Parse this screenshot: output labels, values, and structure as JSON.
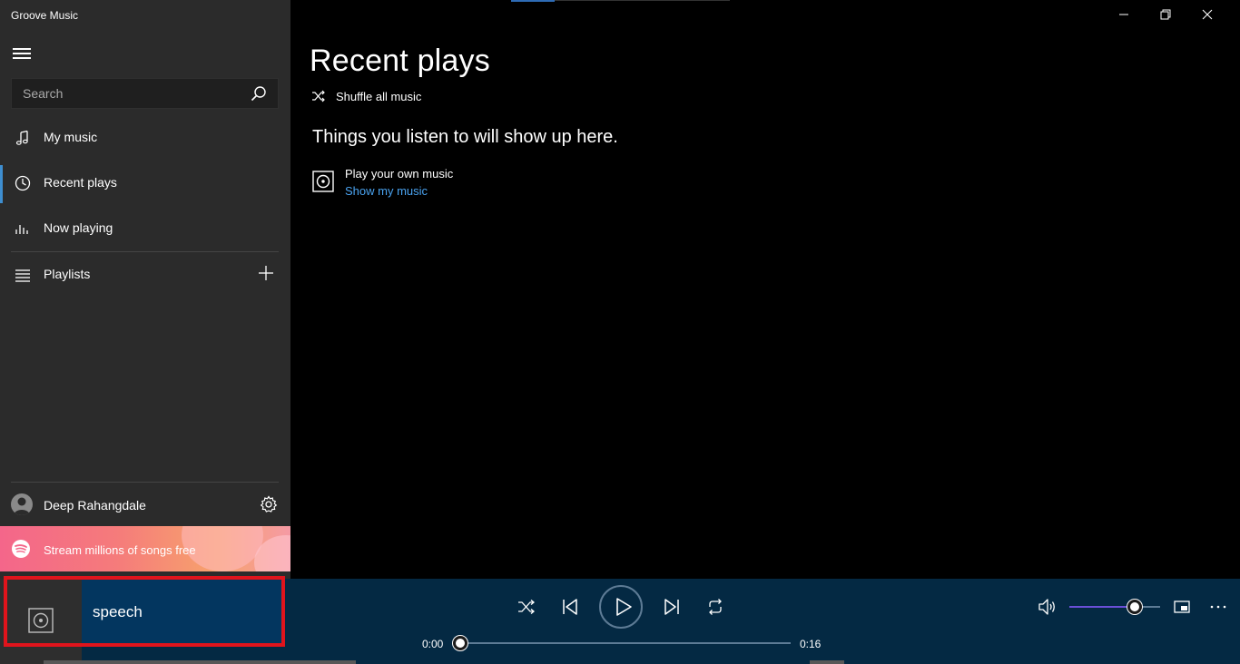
{
  "window": {
    "title": "Groove Music",
    "controls": [
      "minimize-icon",
      "restore-icon",
      "close-icon"
    ]
  },
  "sidebar": {
    "search": {
      "placeholder": "Search",
      "value": ""
    },
    "nav": [
      {
        "label": "My music",
        "icon": "music-note-icon"
      },
      {
        "label": "Recent plays",
        "icon": "clock-icon",
        "active": true
      },
      {
        "label": "Now playing",
        "icon": "equalizer-icon"
      }
    ],
    "playlists": {
      "label": "Playlists",
      "icon": "list-icon",
      "add_icon": "add-icon"
    },
    "user": {
      "name": "Deep Rahangdale",
      "icon": "settings-icon"
    },
    "promo": {
      "text": "Stream millions of songs free",
      "icon": "spotify-icon"
    }
  },
  "main": {
    "title": "Recent plays",
    "shuffle_label": "Shuffle all music",
    "empty_message": "Things you listen to will show up here.",
    "own_music": {
      "title": "Play your own music",
      "link": "Show my music"
    }
  },
  "player": {
    "track_title": "speech",
    "time_current": "0:00",
    "time_total": "0:16",
    "progress_fraction": 0.0,
    "volume_fraction": 0.72,
    "accent_color": "#6b4fd8",
    "link_color": "#4aa3f0",
    "active_nav_color": "#3e8ed0"
  }
}
